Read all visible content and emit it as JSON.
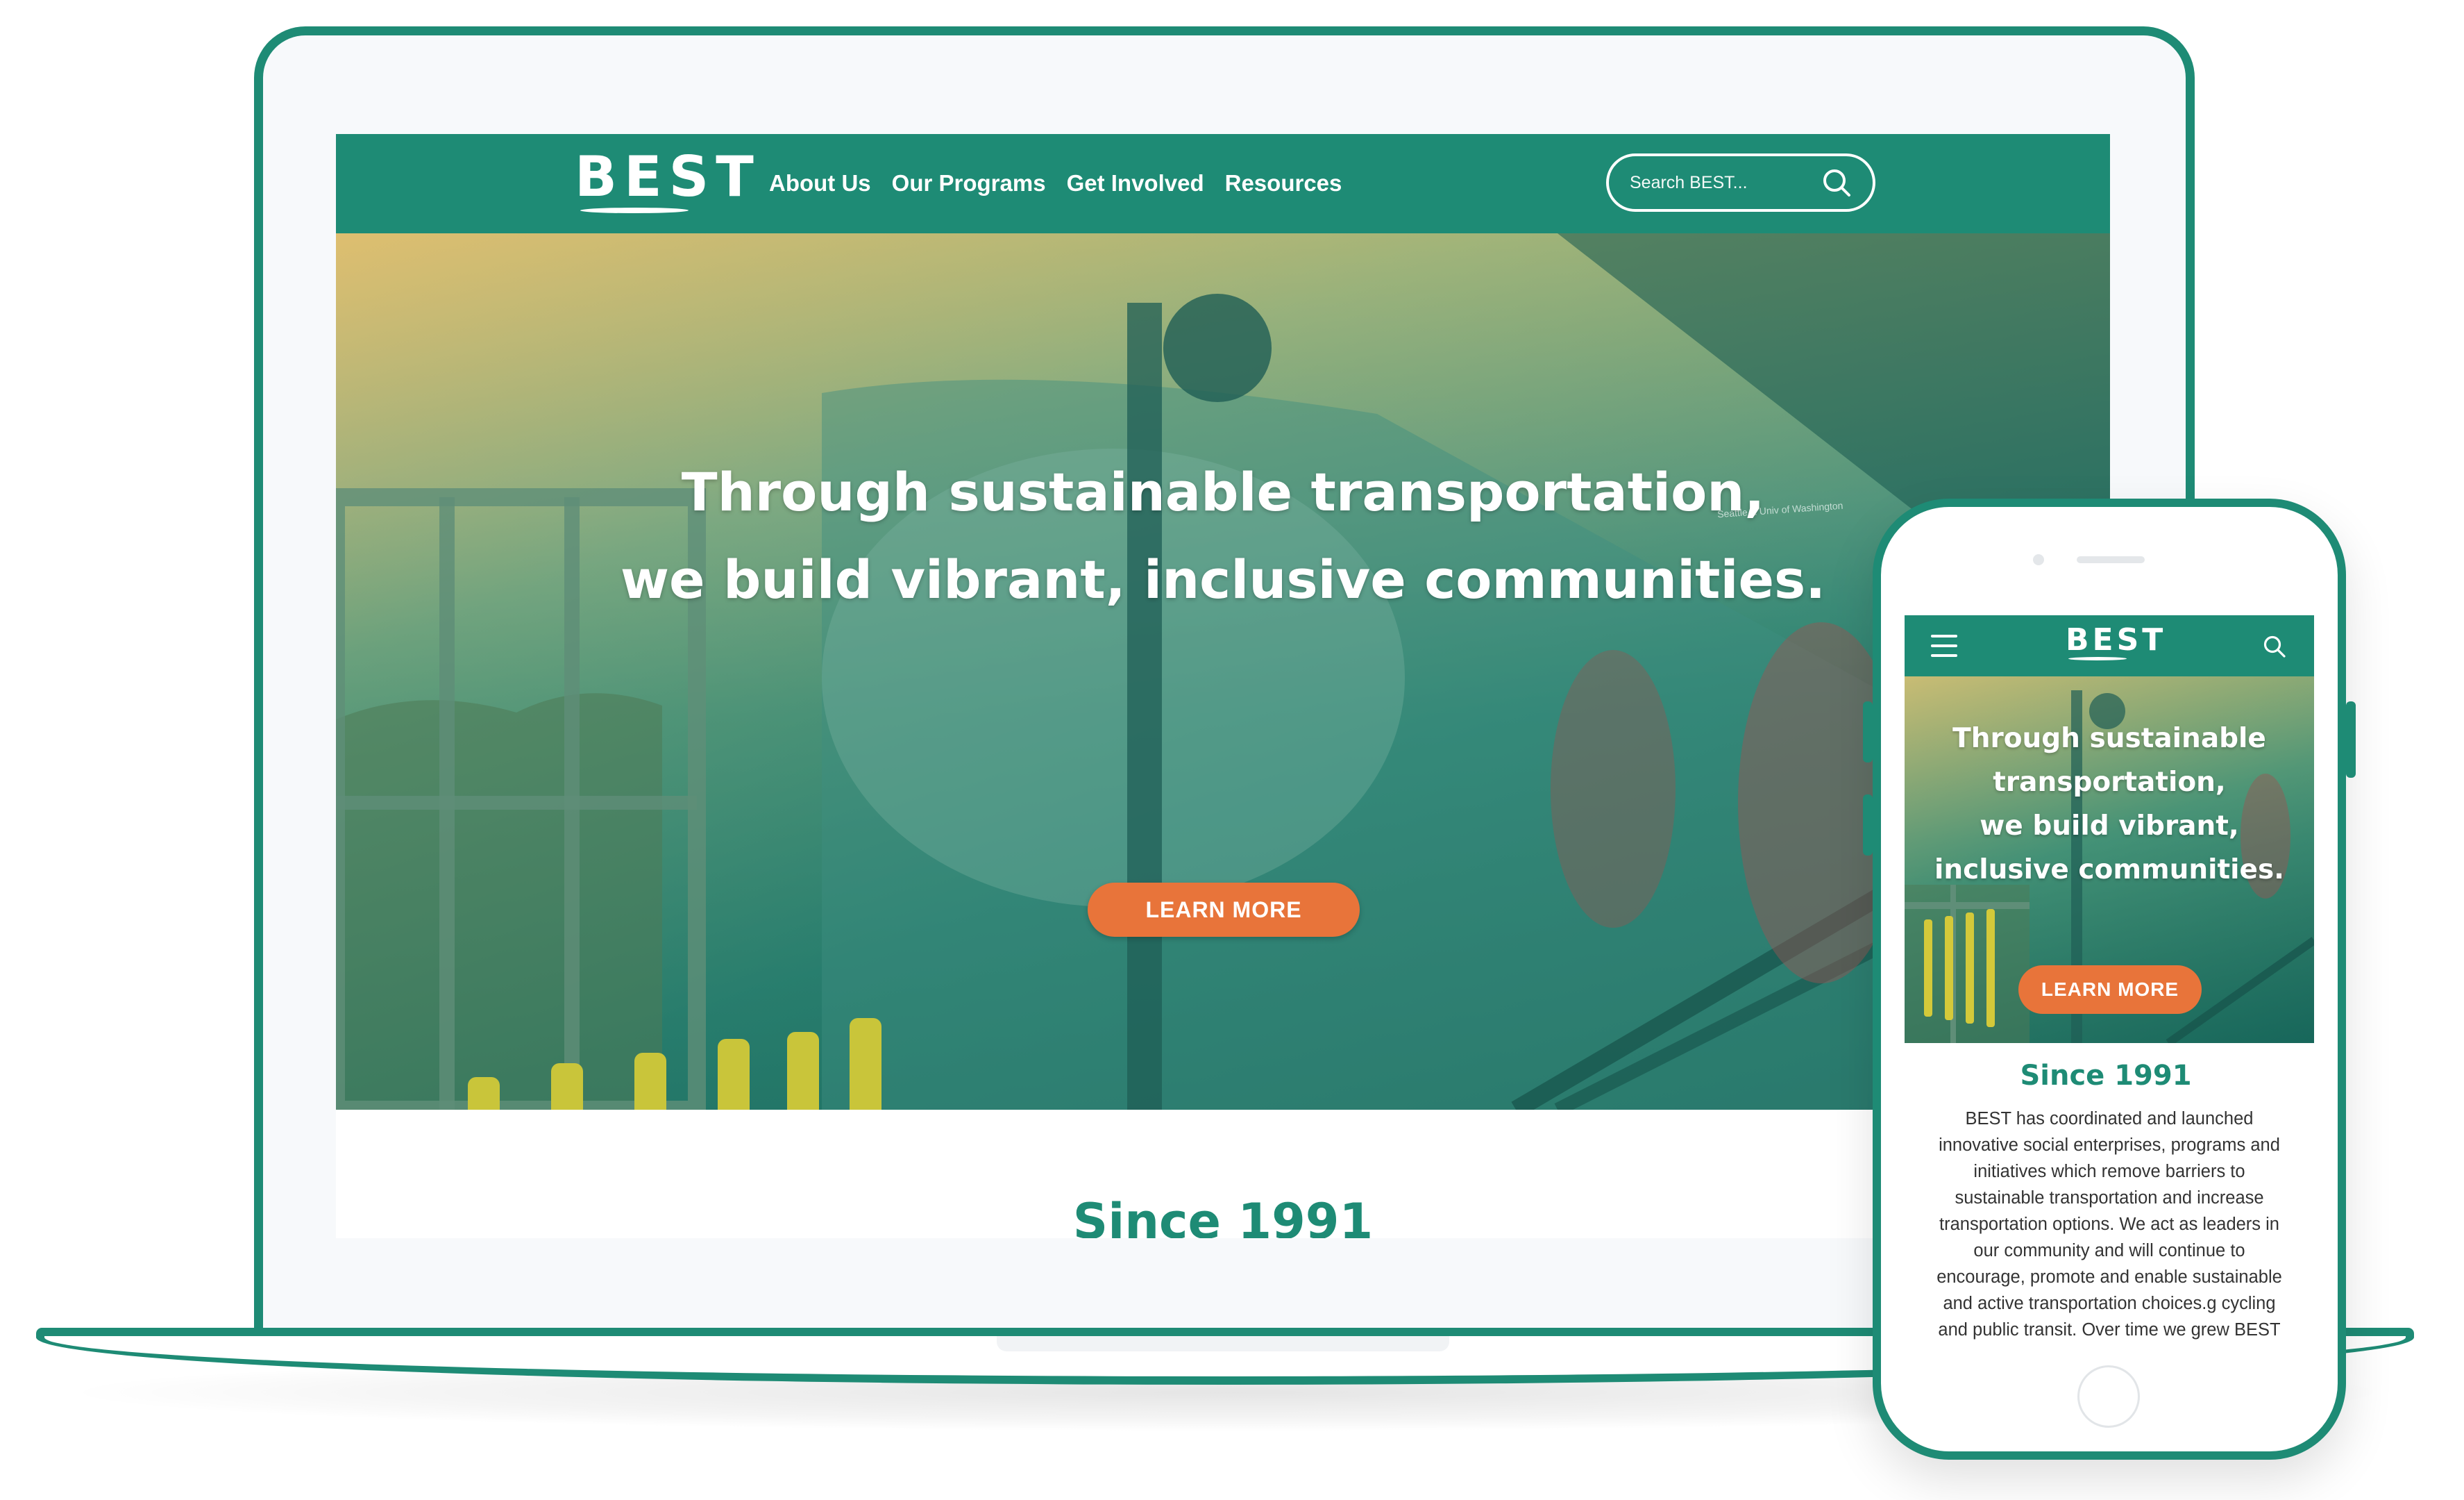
{
  "brand": {
    "logo_text": "BEST",
    "color": "#1e8b75",
    "accent": "#e8743a"
  },
  "desktop": {
    "nav": [
      "About Us",
      "Our Programs",
      "Get Involved",
      "Resources"
    ],
    "search": {
      "placeholder": "Search BEST..."
    },
    "hero": {
      "title_line1": "Through sustainable transportation,",
      "title_line2": "we build vibrant, inclusive communities.",
      "cta": "LEARN MORE",
      "sign_text": "Seattle & Univ of Washington"
    },
    "section_title": "Since 1991"
  },
  "mobile": {
    "hero": {
      "title_lines": [
        "Through sustainable",
        "transportation,",
        "we build vibrant,",
        "inclusive communities."
      ],
      "cta": "LEARN MORE"
    },
    "section_title": "Since 1991",
    "body_lines": [
      "BEST has coordinated and launched",
      "innovative social enterprises, programs and",
      "initiatives which remove barriers to",
      "sustainable transportation and increase",
      "transportation options. We act as leaders in",
      "our community and will continue to",
      "encourage, promote and enable sustainable",
      "and active transportation choices.g cycling",
      "and public transit. Over time we grew BEST"
    ]
  }
}
